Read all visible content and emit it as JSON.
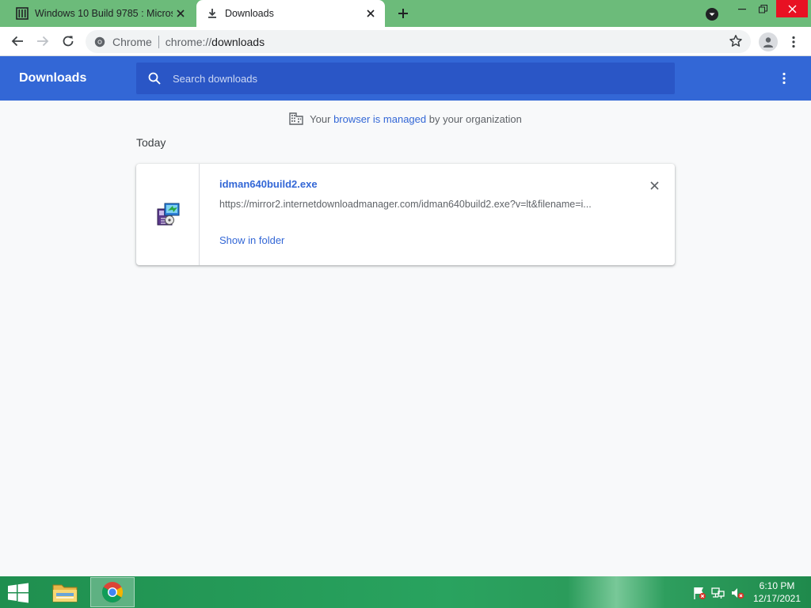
{
  "tabs": [
    {
      "title": "Windows 10 Build 9785 : Microsoft",
      "icon": "archive-icon",
      "active": false
    },
    {
      "title": "Downloads",
      "icon": "download-icon",
      "active": true
    }
  ],
  "toolbar": {
    "site_label": "Chrome",
    "url_scheme": "chrome://",
    "url_host": "downloads"
  },
  "downloads_page": {
    "title": "Downloads",
    "search_placeholder": "Search downloads",
    "managed_prefix": "Your ",
    "managed_link": "browser is managed",
    "managed_suffix": " by your organization",
    "date_group": "Today"
  },
  "download_item": {
    "filename": "idman640build2.exe",
    "url": "https://mirror2.internetdownloadmanager.com/idman640build2.exe?v=lt&filename=i...",
    "action_label": "Show in folder",
    "icon": "installer-icon"
  },
  "taskbar": {
    "time": "6:10 PM",
    "date": "12/17/2021"
  },
  "colors": {
    "tab_strip": "#6cbb7a",
    "header_blue": "#3367d6",
    "search_blue": "#2a56c6",
    "link_blue": "#3367d6",
    "taskbar_green": "#29a35f",
    "close_red": "#e81123"
  }
}
